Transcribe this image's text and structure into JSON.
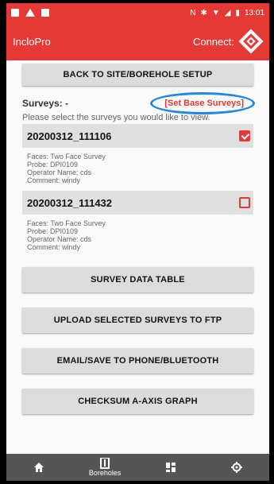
{
  "statusbar": {
    "time": "13:01"
  },
  "appbar": {
    "title": "IncloPro",
    "connect_label": "Connect:"
  },
  "back_button": "BACK TO SITE/BOREHOLE SETUP",
  "surveys": {
    "label": "Surveys: -",
    "set_base": "[Set Base Surveys]",
    "instruction": "Please select the surveys you would like to view."
  },
  "cards": [
    {
      "title": "20200312_111106",
      "checked": true,
      "faces": "Faces: Two Face Survey",
      "probe": "Probe: DPI0109",
      "operator": "Operator Name: cds",
      "comment": "Comment: windy"
    },
    {
      "title": "20200312_111432",
      "checked": false,
      "faces": "Faces: Two Face Survey",
      "probe": "Probe: DPI0109",
      "operator": "Operator Name: cds",
      "comment": "Comment: windy"
    }
  ],
  "actions": {
    "survey_table": "SURVEY DATA TABLE",
    "upload": "UPLOAD SELECTED SURVEYS TO FTP",
    "email": "EMAIL/SAVE TO PHONE/BLUETOOTH",
    "checksum": "CHECKSUM A-AXIS GRAPH"
  },
  "nav": {
    "boreholes_label": "Boreholes"
  },
  "colors": {
    "accent": "#e53935",
    "highlight_ring": "#1e88e5",
    "nav_bg": "#555555"
  }
}
